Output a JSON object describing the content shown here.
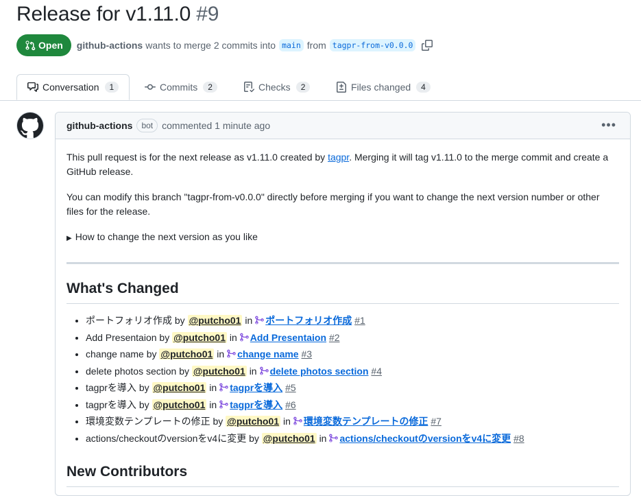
{
  "pr": {
    "title": "Release for v1.11.0",
    "number": "#9",
    "state": "Open",
    "author": "github-actions",
    "merge_text": "wants to merge 2 commits into",
    "base_branch": "main",
    "from_text": "from",
    "head_branch": "tagpr-from-v0.0.0"
  },
  "tabs": [
    {
      "label": "Conversation",
      "count": "1",
      "icon": "comment-discussion-icon"
    },
    {
      "label": "Commits",
      "count": "2",
      "icon": "git-commit-icon"
    },
    {
      "label": "Checks",
      "count": "2",
      "icon": "checklist-icon"
    },
    {
      "label": "Files changed",
      "count": "4",
      "icon": "file-diff-icon"
    }
  ],
  "comment": {
    "author": "github-actions",
    "badge": "bot",
    "time": "commented 1 minute ago",
    "para1_a": "This pull request is for the next release as v1.11.0 created by ",
    "para1_link": "tagpr",
    "para1_b": ". Merging it will tag v1.11.0 to the merge commit and create a GitHub release.",
    "para2": "You can modify this branch \"tagpr-from-v0.0.0\" directly before merging if you want to change the next version number or other files for the release.",
    "details_summary": "How to change the next version as you like",
    "heading_changed": "What's Changed",
    "heading_contributors": "New Contributors",
    "by": "by",
    "in": "in",
    "changes": [
      {
        "text": "ポートフォリオ作成",
        "user": "@putcho01",
        "pr_title": "ポートフォリオ作成",
        "pr_num": "#1"
      },
      {
        "text": "Add Presentaion",
        "user": "@putcho01",
        "pr_title": "Add Presentaion",
        "pr_num": "#2"
      },
      {
        "text": "change name",
        "user": "@putcho01",
        "pr_title": "change name",
        "pr_num": "#3"
      },
      {
        "text": "delete photos section",
        "user": "@putcho01",
        "pr_title": "delete photos section",
        "pr_num": "#4"
      },
      {
        "text": "tagprを導入",
        "user": "@putcho01",
        "pr_title": "tagprを導入",
        "pr_num": "#5"
      },
      {
        "text": "tagprを導入",
        "user": "@putcho01",
        "pr_title": "tagprを導入",
        "pr_num": "#6"
      },
      {
        "text": "環境変数テンプレートの修正",
        "user": "@putcho01",
        "pr_title": "環境変数テンプレートの修正",
        "pr_num": "#7"
      },
      {
        "text": "actions/checkoutのversionをv4に変更",
        "user": "@putcho01",
        "pr_title": "actions/checkoutのversionをv4に変更",
        "pr_num": "#8"
      }
    ]
  },
  "colors": {
    "open_green": "#1f883d",
    "link_blue": "#0969da",
    "mention_bg": "#fff8c5",
    "merged_purple": "#8250df"
  }
}
